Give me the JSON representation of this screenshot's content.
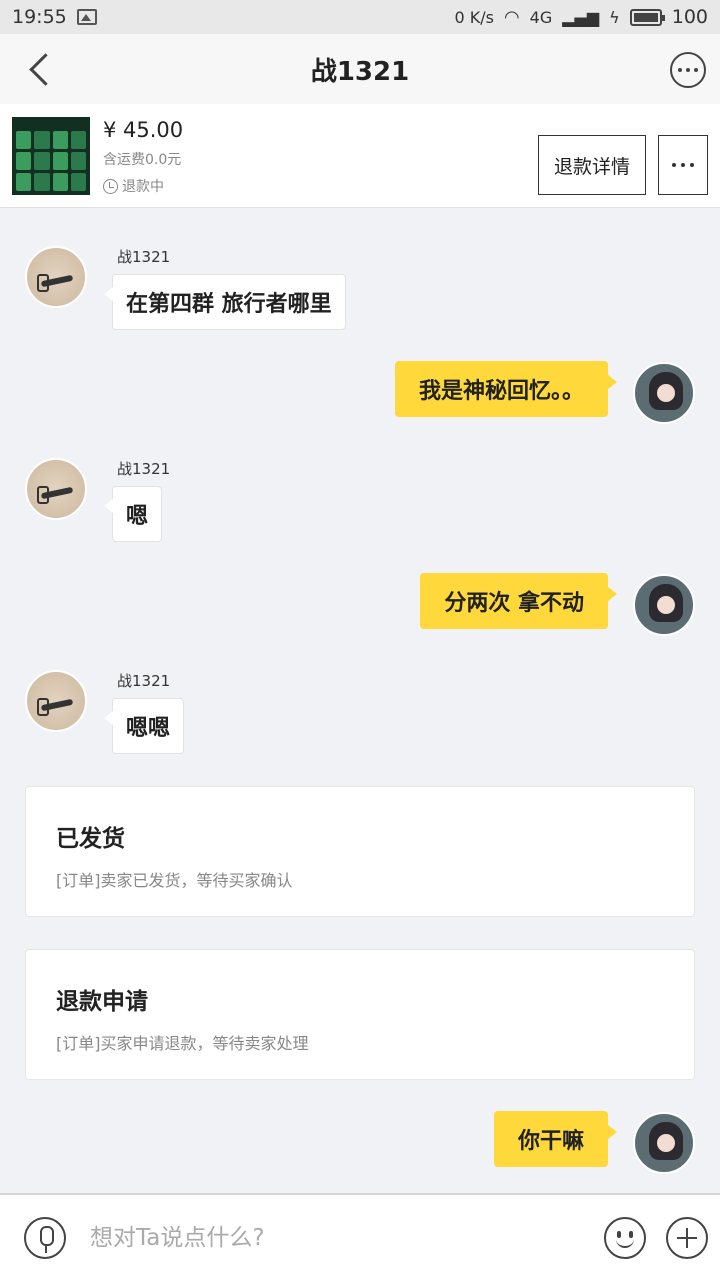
{
  "status_bar": {
    "time": "19:55",
    "net_speed": "0 K/s",
    "signal": "4G",
    "battery": "100",
    "battery_level": 1.0
  },
  "header": {
    "title": "战1321",
    "back_icon": "chevron-left-icon",
    "more_icon": "more-circle-icon"
  },
  "order": {
    "price": "¥ 45.00",
    "shipping": "含运费0.0元",
    "status": "退款中",
    "refund_button": "退款详情",
    "more_button_icon": "ellipsis-icon"
  },
  "chat": {
    "messages": [
      {
        "from": "seller",
        "name": "战1321",
        "text": "在第四群 旅行者哪里"
      },
      {
        "from": "me",
        "text": "我是神秘回忆。。"
      },
      {
        "from": "seller",
        "name": "战1321",
        "text": "嗯"
      },
      {
        "from": "me",
        "text": "分两次 拿不动"
      },
      {
        "from": "seller",
        "name": "战1321",
        "text": "嗯嗯"
      }
    ],
    "cards": [
      {
        "title": "已发货",
        "desc": "[订单]卖家已发货，等待买家确认"
      },
      {
        "title": "退款申请",
        "desc": "[订单]买家申请退款，等待卖家处理"
      }
    ],
    "last_message": {
      "from": "me",
      "text": "你干嘛"
    }
  },
  "input_bar": {
    "placeholder": "想对Ta说点什么?",
    "value": "",
    "voice_icon": "microphone-icon",
    "emoji_icon": "emoji-icon",
    "plus_icon": "plus-icon"
  },
  "colors": {
    "my_bubble": "#ffd83c",
    "background": "#f0f2f5"
  }
}
